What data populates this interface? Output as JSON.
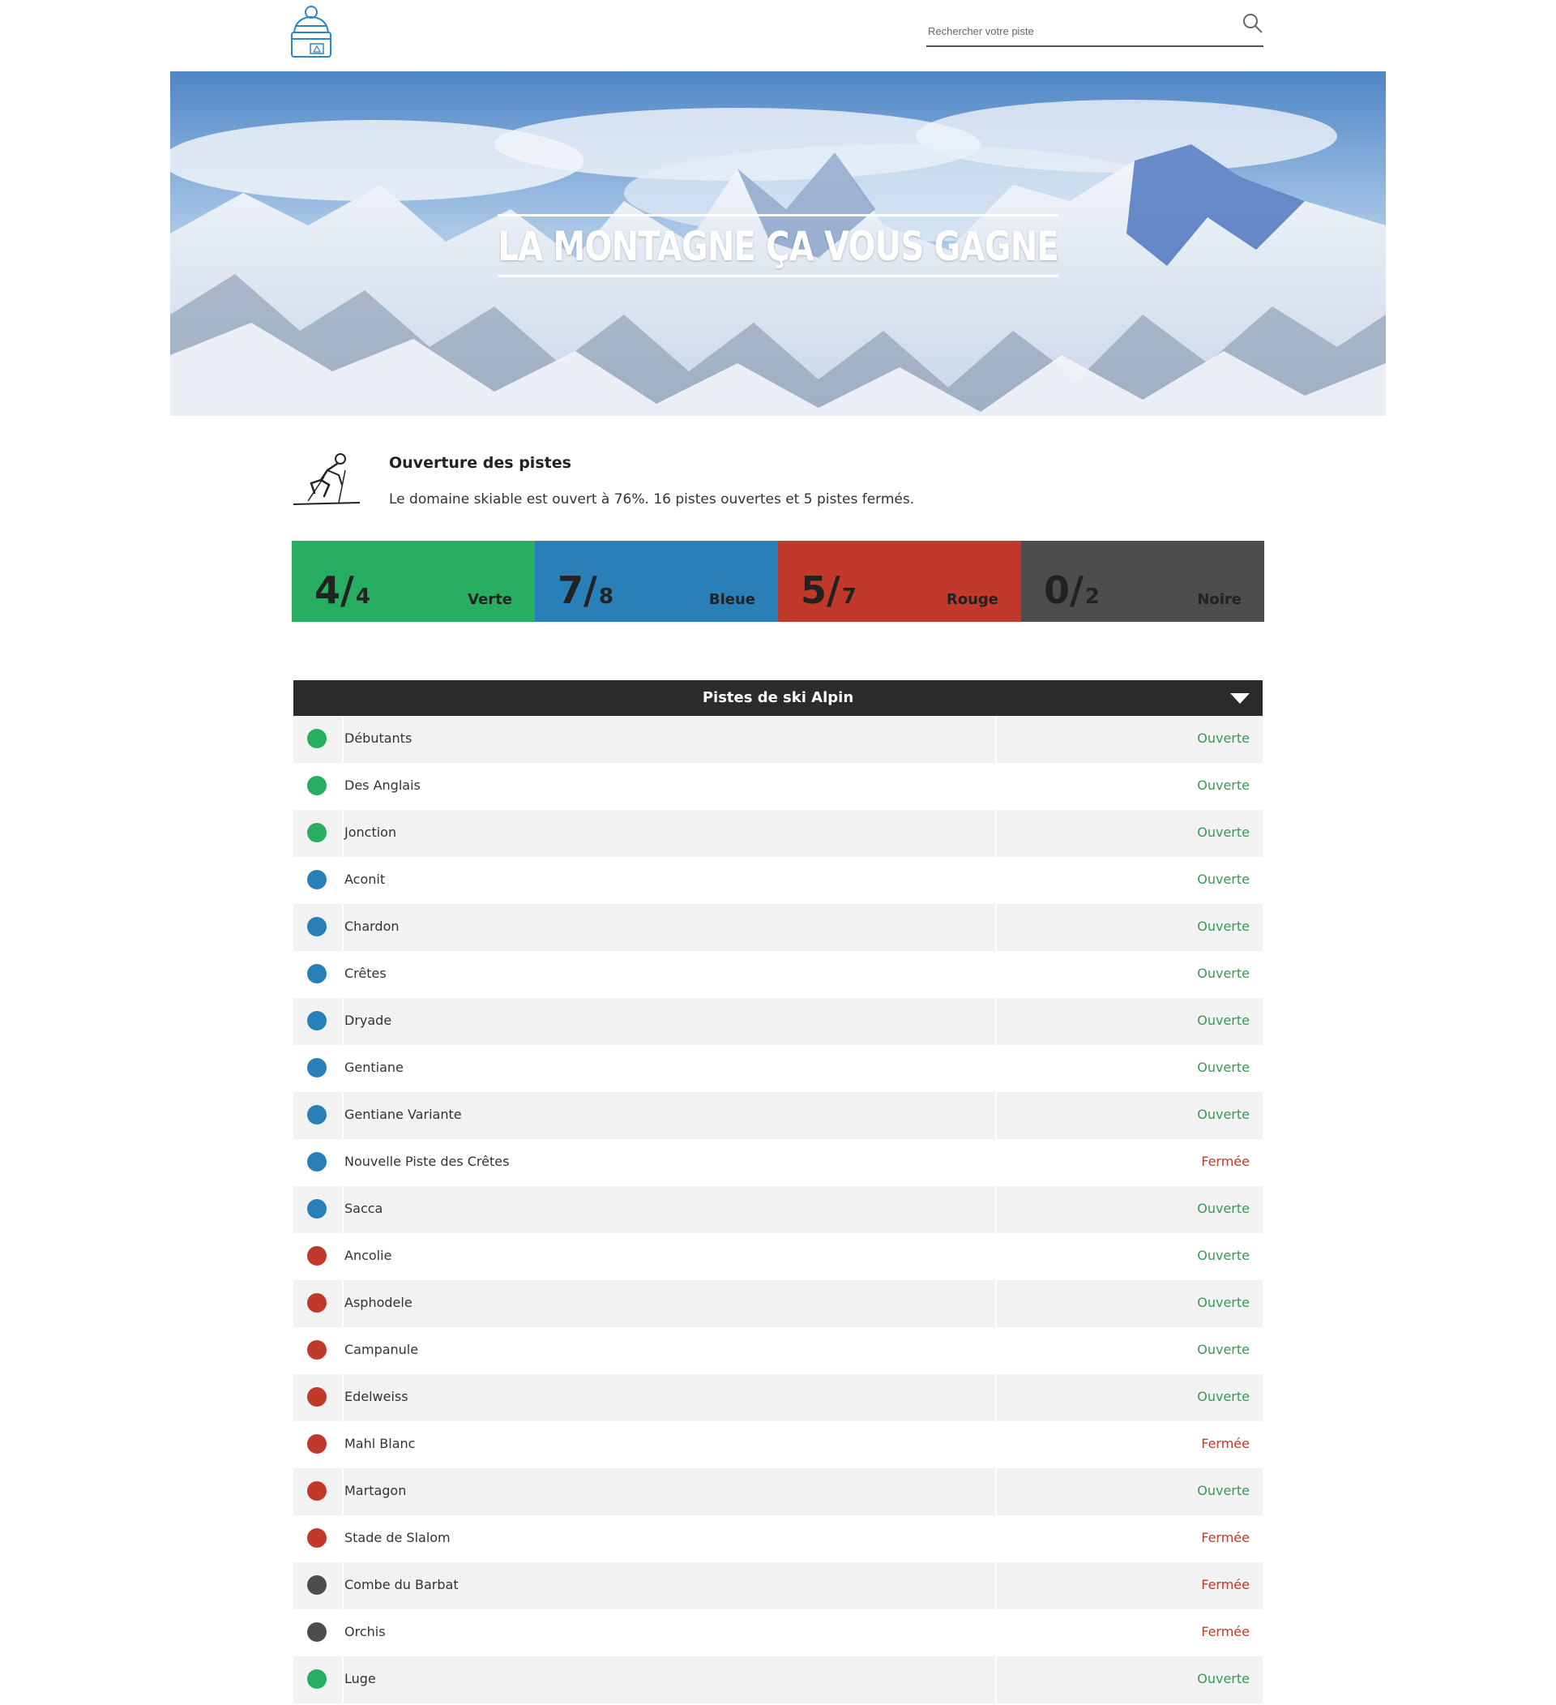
{
  "header": {
    "logo_icon": "beanie-hat-icon",
    "search": {
      "placeholder": "Rechercher votre piste",
      "icon": "search-icon"
    }
  },
  "hero": {
    "title": "LA MONTAGNE ÇA VOUS GAGNE"
  },
  "opening": {
    "icon": "skier-icon",
    "title": "Ouverture des pistes",
    "text": "Le domaine skiable est ouvert à 76%. 16 pistes ouvertes et 5 pistes fermés."
  },
  "stats": [
    {
      "open": "4/",
      "total": "4",
      "label": "Verte",
      "color": "#27ae60"
    },
    {
      "open": "7/",
      "total": "8",
      "label": "Bleue",
      "color": "#2980b9"
    },
    {
      "open": "5/",
      "total": "7",
      "label": "Rouge",
      "color": "#c0392b"
    },
    {
      "open": "0/",
      "total": "2",
      "label": "Noire",
      "color": "#4d4d4d"
    }
  ],
  "slopes": {
    "header": "Pistes de ski Alpin",
    "status_colors": {
      "Ouverte": "#2f9e56",
      "Fermée": "#c0392b"
    },
    "level_colors": {
      "verte": "#27ae60",
      "bleue": "#2980b9",
      "rouge": "#c0392b",
      "noire": "#4d4d4d"
    },
    "rows": [
      {
        "name": "Débutants",
        "level": "verte",
        "status": "Ouverte"
      },
      {
        "name": "Des Anglais",
        "level": "verte",
        "status": "Ouverte"
      },
      {
        "name": "Jonction",
        "level": "verte",
        "status": "Ouverte"
      },
      {
        "name": "Aconit",
        "level": "bleue",
        "status": "Ouverte"
      },
      {
        "name": "Chardon",
        "level": "bleue",
        "status": "Ouverte"
      },
      {
        "name": "Crêtes",
        "level": "bleue",
        "status": "Ouverte"
      },
      {
        "name": "Dryade",
        "level": "bleue",
        "status": "Ouverte"
      },
      {
        "name": "Gentiane",
        "level": "bleue",
        "status": "Ouverte"
      },
      {
        "name": "Gentiane Variante",
        "level": "bleue",
        "status": "Ouverte"
      },
      {
        "name": "Nouvelle Piste des Crêtes",
        "level": "bleue",
        "status": "Fermée"
      },
      {
        "name": "Sacca",
        "level": "bleue",
        "status": "Ouverte"
      },
      {
        "name": "Ancolie",
        "level": "rouge",
        "status": "Ouverte"
      },
      {
        "name": "Asphodele",
        "level": "rouge",
        "status": "Ouverte"
      },
      {
        "name": "Campanule",
        "level": "rouge",
        "status": "Ouverte"
      },
      {
        "name": "Edelweiss",
        "level": "rouge",
        "status": "Ouverte"
      },
      {
        "name": "Mahl Blanc",
        "level": "rouge",
        "status": "Fermée"
      },
      {
        "name": "Martagon",
        "level": "rouge",
        "status": "Ouverte"
      },
      {
        "name": "Stade de Slalom",
        "level": "rouge",
        "status": "Fermée"
      },
      {
        "name": "Combe du Barbat",
        "level": "noire",
        "status": "Fermée"
      },
      {
        "name": "Orchis",
        "level": "noire",
        "status": "Fermée"
      },
      {
        "name": "Luge",
        "level": "verte",
        "status": "Ouverte"
      }
    ]
  }
}
